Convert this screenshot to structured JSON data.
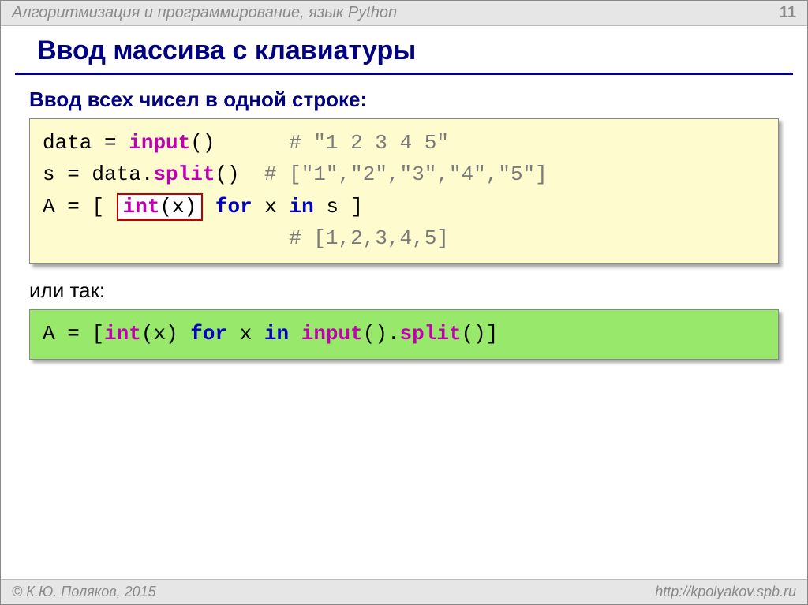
{
  "header": {
    "course": "Алгоритмизация и программирование, язык Python",
    "page": "11"
  },
  "title": "Ввод массива с клавиатуры",
  "subhead1": "Ввод всех чисел в одной строке:",
  "code1": {
    "l1_a": "data",
    "l1_eq": " = ",
    "l1_b": "input",
    "l1_c": "()",
    "l1_pad": "      ",
    "l1_cmt": "# \"1 2 3 4 5\"",
    "l2_a": "s",
    "l2_eq": " = ",
    "l2_b": "data.",
    "l2_c": "split",
    "l2_d": "()",
    "l2_pad": "  ",
    "l2_cmt": "# [\"1\",\"2\",\"3\",\"4\",\"5\"]",
    "l3_a": "A",
    "l3_eq": " = ",
    "l3_b": "[ ",
    "l3_hi_a": "int",
    "l3_hi_b": "(x)",
    "l3_c": " ",
    "l3_for": "for",
    "l3_d": " x ",
    "l3_in": "in",
    "l3_e": " s ]",
    "l4_pad": "                    ",
    "l4_cmt": "# [1,2,3,4,5]"
  },
  "subhead2": "или так:",
  "code2": {
    "a": "A",
    "eq": " = ",
    "b": "[",
    "int": "int",
    "c": "(x) ",
    "for": "for",
    "d": " x ",
    "in": "in",
    "e": " ",
    "input": "input",
    "f": "().",
    "split": "split",
    "g": "()]"
  },
  "footer": {
    "copyright": "© К.Ю. Поляков, 2015",
    "url": "http://kpolyakov.spb.ru"
  }
}
